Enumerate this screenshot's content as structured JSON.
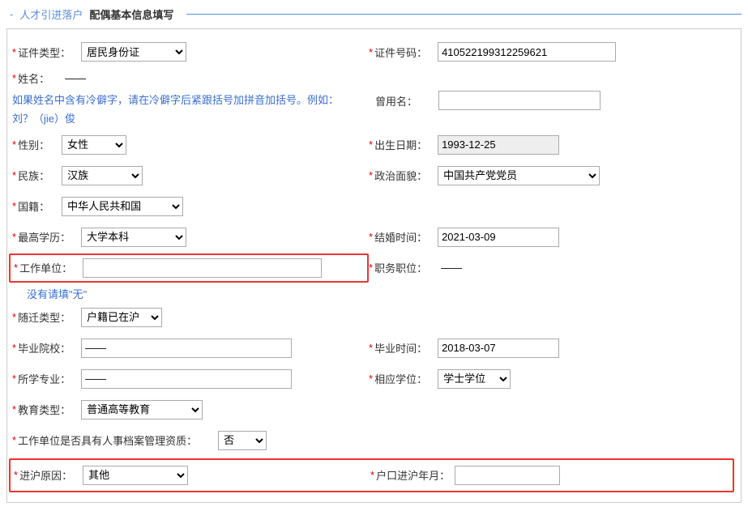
{
  "header": {
    "section": "人才引进落户",
    "title": "配偶基本信息填写"
  },
  "labels": {
    "id_type": "证件类型：",
    "id_number": "证件号码：",
    "name": "姓名：",
    "former_name": "曾用名：",
    "gender": "性别：",
    "birth_date": "出生日期：",
    "ethnicity": "民族：",
    "political": "政治面貌：",
    "nationality": "国籍：",
    "education": "最高学历：",
    "marriage_time": "结婚时间：",
    "work_unit": "工作单位：",
    "position": "职务职位：",
    "move_type": "随迁类型：",
    "grad_school": "毕业院校：",
    "grad_time": "毕业时间：",
    "major": "所学专业：",
    "degree": "相应学位：",
    "edu_type": "教育类型：",
    "hr_qualification": "工作单位是否具有人事档案管理资质：",
    "sh_reason": "进沪原因：",
    "sh_date": "户口进沪年月："
  },
  "hints": {
    "rare_char": "如果姓名中含有冷僻字，请在冷僻字后紧跟括号加拼音加括号。例如：刘？（jie）俊",
    "no_unit": "没有请填\"无\""
  },
  "values": {
    "id_type": "居民身份证",
    "id_number": "410522199312259621",
    "name": "——",
    "former_name": "",
    "gender": "女性",
    "birth_date": "1993-12-25",
    "ethnicity": "汉族",
    "political": "中国共产党党员",
    "nationality": "中华人民共和国",
    "education": "大学本科",
    "marriage_time": "2021-03-09",
    "work_unit": "",
    "position": "——",
    "move_type": "户籍已在沪",
    "grad_school": "——",
    "grad_time": "2018-03-07",
    "major": "——",
    "degree": "学士学位",
    "edu_type": "普通高等教育",
    "hr_qualification": "否",
    "sh_reason": "其他",
    "sh_date": ""
  }
}
